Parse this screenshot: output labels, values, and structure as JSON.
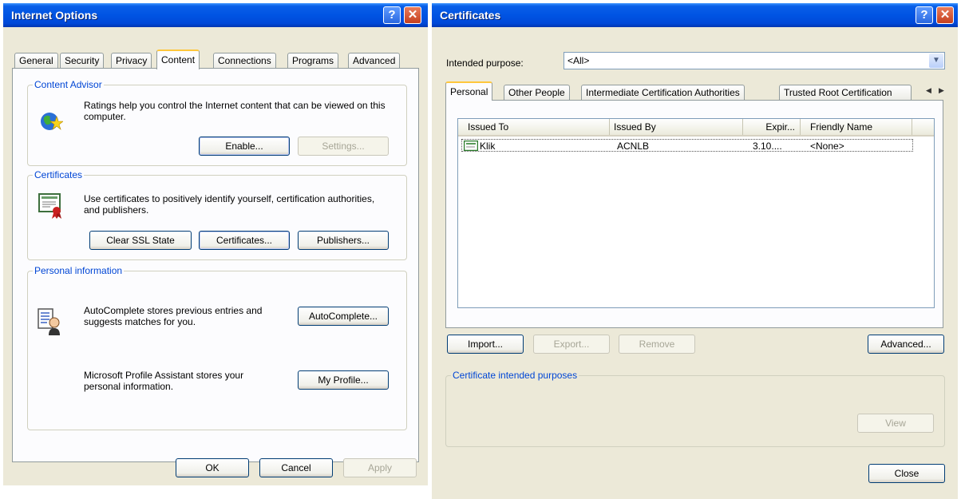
{
  "internet_options": {
    "title": "Internet Options",
    "tabs": [
      "General",
      "Security",
      "Privacy",
      "Content",
      "Connections",
      "Programs",
      "Advanced"
    ],
    "active_tab": "Content",
    "content_advisor": {
      "title": "Content Advisor",
      "text": "Ratings help you control the Internet content that can be viewed on this computer.",
      "enable_label": "Enable...",
      "settings_label": "Settings..."
    },
    "certificates": {
      "title": "Certificates",
      "text": "Use certificates to positively identify yourself, certification authorities, and publishers.",
      "clear_ssl_label": "Clear SSL State",
      "certificates_label": "Certificates...",
      "publishers_label": "Publishers..."
    },
    "personal_information": {
      "title": "Personal information",
      "autocomplete_text": "AutoComplete stores previous entries and suggests matches for you.",
      "autocomplete_label": "AutoComplete...",
      "profile_text": "Microsoft Profile Assistant stores your personal information.",
      "profile_label": "My Profile..."
    },
    "ok_label": "OK",
    "cancel_label": "Cancel",
    "apply_label": "Apply"
  },
  "certificates_dialog": {
    "title": "Certificates",
    "intended_purpose_label": "Intended purpose:",
    "intended_purpose_value": "<All>",
    "tabs": [
      "Personal",
      "Other People",
      "Intermediate Certification Authorities",
      "Trusted Root Certification"
    ],
    "active_tab": "Personal",
    "columns": [
      "Issued To",
      "Issued By",
      "Expir...",
      "Friendly Name"
    ],
    "rows": [
      {
        "issued_to": "Klik",
        "issued_by": "ACNLB",
        "expiration": "3.10....",
        "friendly_name": "<None>"
      }
    ],
    "import_label": "Import...",
    "export_label": "Export...",
    "remove_label": "Remove",
    "advanced_label": "Advanced...",
    "intended_purposes_title": "Certificate intended purposes",
    "view_label": "View",
    "close_label": "Close"
  },
  "colors": {
    "title_bar": "#0054e3",
    "dialog_bg": "#ece9d8",
    "group_title": "#0046d5",
    "close_button": "#c5401f"
  },
  "icons": {
    "content_advisor": "globe-star-icon",
    "certificates": "certificate-ribbon-icon",
    "autocomplete": "autocomplete-person-icon",
    "certificate_row": "certificate-small-icon"
  }
}
